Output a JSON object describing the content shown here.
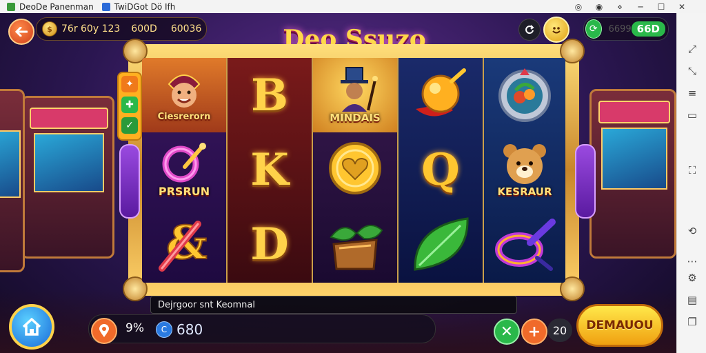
{
  "titlebar": {
    "app1": "DeoDe Panenman",
    "app2": "TwiDGot Dö Ifh",
    "app1_icon": "green-cube-icon",
    "app2_icon": "blue-app-icon"
  },
  "hud": {
    "coins_text": "76r 60y 123",
    "coins_value": "600D",
    "coins_value2": "60036",
    "right_value": "66D",
    "right_value_faded": "6699",
    "back_icon": "back-arrow-icon"
  },
  "game": {
    "title": "Deo Ssuzo"
  },
  "reels": [
    {
      "cells": [
        {
          "type": "character",
          "label": "Ciesrerorn",
          "icon": "jester-face-icon"
        },
        {
          "type": "character",
          "label": "PRSRUN",
          "icon": "q-wand-icon"
        },
        {
          "type": "icon",
          "label": "",
          "icon": "ampersand-stick-icon"
        }
      ]
    },
    {
      "cells": [
        {
          "type": "letter",
          "label": "B",
          "icon": "letter-b-icon"
        },
        {
          "type": "letter",
          "label": "K",
          "icon": "letter-k-icon"
        },
        {
          "type": "letter",
          "label": "D",
          "icon": "letter-d-icon"
        }
      ]
    },
    {
      "cells": [
        {
          "type": "character",
          "label": "MINDAIS",
          "icon": "magician-icon"
        },
        {
          "type": "icon",
          "label": "",
          "icon": "gold-heart-coin-icon"
        },
        {
          "type": "icon",
          "label": "",
          "icon": "treasure-leaf-icon"
        }
      ]
    },
    {
      "cells": [
        {
          "type": "icon",
          "label": "",
          "icon": "golden-orb-icon"
        },
        {
          "type": "letter",
          "label": "Q",
          "icon": "letter-q-icon"
        },
        {
          "type": "icon",
          "label": "",
          "icon": "green-leaf-icon"
        }
      ]
    },
    {
      "cells": [
        {
          "type": "icon",
          "label": "",
          "icon": "fruit-badge-icon"
        },
        {
          "type": "character",
          "label": "KESRAUR",
          "icon": "bear-face-icon"
        },
        {
          "type": "icon",
          "label": "",
          "icon": "ribbon-knot-icon"
        }
      ]
    }
  ],
  "side_left_tabs": [
    "orange-tab-icon",
    "green-tab-icon",
    "green-check-tab-icon"
  ],
  "message": "Dejrgoor snt Keomnal",
  "bottom": {
    "percent": "9%",
    "balance": "680",
    "bet": "20",
    "spin_label": "DEMAUOU"
  },
  "colors": {
    "accent_gold": "#ffd24a",
    "spin_yellow": "#ffe84a",
    "purple_bg": "#2a1650"
  }
}
